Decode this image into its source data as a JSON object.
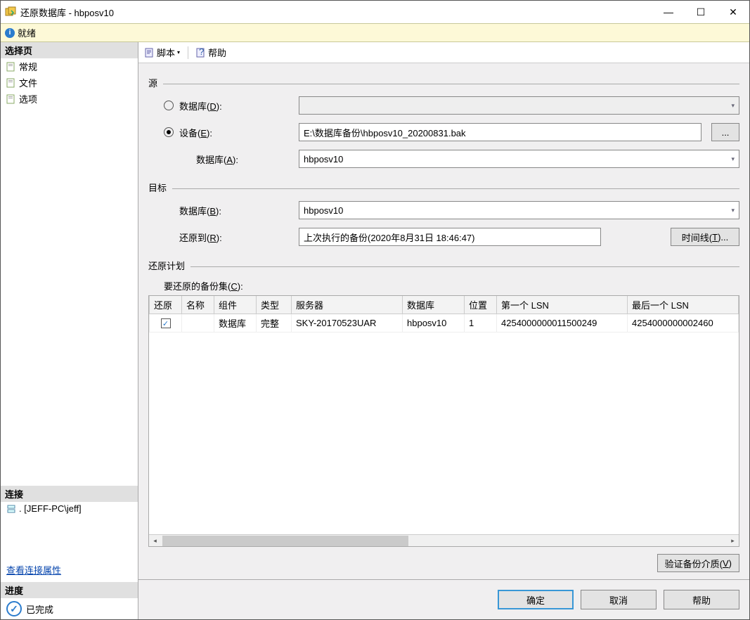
{
  "window": {
    "title": "还原数据库 - hbposv10"
  },
  "status": {
    "text": "就绪"
  },
  "sidebar": {
    "select_page": "选择页",
    "items": [
      "常规",
      "文件",
      "选项"
    ],
    "connection_hdr": "连接",
    "connection_val": ". [JEFF-PC\\jeff]",
    "view_props": "查看连接属性",
    "progress_hdr": "进度",
    "progress_val": "已完成"
  },
  "toolbar": {
    "script": "脚本",
    "help": "帮助"
  },
  "source": {
    "hdr": "源",
    "db_label": "数据库(D):",
    "device_label": "设备(E):",
    "device_val": "E:\\数据库备份\\hbposv10_20200831.bak",
    "sub_db_label": "数据库(A):",
    "sub_db_val": "hbposv10"
  },
  "target": {
    "hdr": "目标",
    "db_label": "数据库(B):",
    "db_val": "hbposv10",
    "restore_to_label": "还原到(R):",
    "restore_to_val": "上次执行的备份(2020年8月31日 18:46:47)",
    "timeline_btn": "时间线(T)..."
  },
  "plan": {
    "hdr": "还原计划",
    "backupset_label": "要还原的备份集(C):",
    "cols": [
      "还原",
      "名称",
      "组件",
      "类型",
      "服务器",
      "数据库",
      "位置",
      "第一个 LSN",
      "最后一个 LSN"
    ],
    "row": {
      "checked": "✓",
      "name": "",
      "component": "数据库",
      "type": "完整",
      "server": "SKY-20170523UAR",
      "database": "hbposv10",
      "position": "1",
      "first_lsn": "4254000000011500249",
      "last_lsn": "4254000000002460"
    },
    "verify_btn": "验证备份介质(V)"
  },
  "footer": {
    "ok": "确定",
    "cancel": "取消",
    "help": "帮助"
  }
}
